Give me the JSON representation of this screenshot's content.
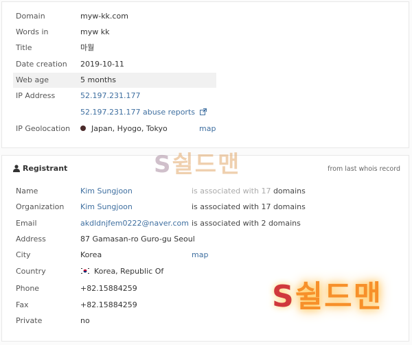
{
  "domain_info": {
    "rows": [
      {
        "label": "Domain",
        "value": "myw-kk.com"
      },
      {
        "label": "Words in",
        "value": "myw kk"
      },
      {
        "label": "Title",
        "value": "마월"
      },
      {
        "label": "Date creation",
        "value": "2019-10-11"
      },
      {
        "label": "Web age",
        "value": "5 months"
      },
      {
        "label": "IP Address",
        "value": "52.197.231.177"
      }
    ],
    "abuse_link": "52.197.231.177 abuse reports",
    "geolocation": {
      "label": "IP Geolocation",
      "value": "Japan, Hyogo, Tokyo",
      "map": "map"
    }
  },
  "registrant": {
    "title": "Registrant",
    "note": "from last whois record",
    "name": {
      "label": "Name",
      "value": "Kim Sungjoon",
      "assoc_prefix": "is associated with 17",
      "assoc_suffix": "domains"
    },
    "organization": {
      "label": "Organization",
      "value": "Kim Sungjoon",
      "assoc": "is associated with 17 domains"
    },
    "email": {
      "label": "Email",
      "value": "akdldnjfem0222@naver.com",
      "assoc": "is associated with 2 domains"
    },
    "address": {
      "label": "Address",
      "value": "87 Gamasan-ro Guro-gu Seoul"
    },
    "city": {
      "label": "City",
      "value": "Korea",
      "map": "map"
    },
    "country": {
      "label": "Country",
      "value": "Korea, Republic Of"
    },
    "phone": {
      "label": "Phone",
      "value": "+82.15884259"
    },
    "fax": {
      "label": "Fax",
      "value": "+82.15884259"
    },
    "private": {
      "label": "Private",
      "value": "no"
    }
  },
  "watermark": {
    "s": "S",
    "text": "쉴드맨"
  }
}
